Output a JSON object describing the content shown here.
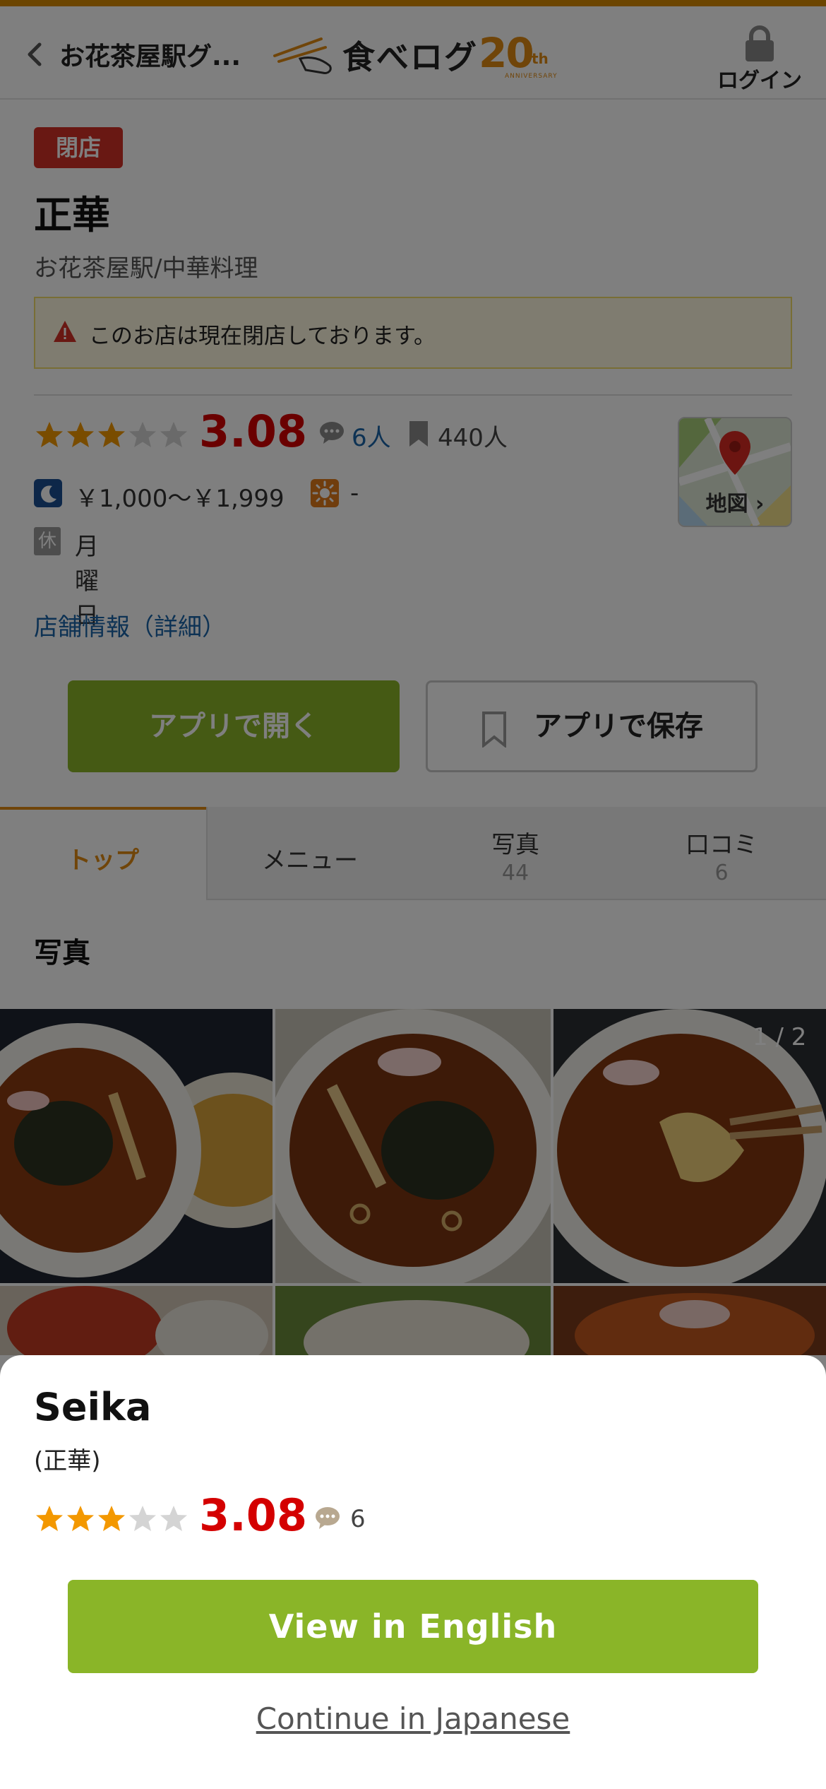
{
  "header": {
    "back_title": "お花茶屋駅グ...",
    "logo_text": "食べログ",
    "logo_anniversary_number": "20",
    "logo_anniversary_suffix": "th",
    "logo_anniversary_word": "ANNIVERSARY",
    "login_label": "ログイン"
  },
  "shop": {
    "closed_badge": "閉店",
    "name": "正華",
    "area_genre": "お花茶屋駅/中華料理",
    "notice": "このお店は現在閉店しております。",
    "rating": 3.08,
    "rating_text": "3.08",
    "review_count": "6人",
    "save_count": "440人",
    "dinner_budget": "￥1,000～￥1,999",
    "lunch_budget": "-",
    "holiday_icon": "休",
    "holiday": "月曜日",
    "map_label": "地図",
    "detail_link": "店舗情報（詳細）"
  },
  "actions": {
    "open_in_app": "アプリで開く",
    "save_in_app": "アプリで保存"
  },
  "tabs": [
    {
      "label": "トップ",
      "count": ""
    },
    {
      "label": "メニュー",
      "count": ""
    },
    {
      "label": "写真",
      "count": "44"
    },
    {
      "label": "口コミ",
      "count": "6"
    }
  ],
  "photos": {
    "heading": "写真",
    "counter": "1 / 2"
  },
  "sheet": {
    "name": "Seika",
    "subtitle": "(正華)",
    "rating_text": "3.08",
    "review_count": "6",
    "primary_button": "View in English",
    "secondary_link": "Continue in Japanese"
  },
  "colors": {
    "accent_orange": "#e08a12",
    "brand_green": "#8ab528",
    "score_red": "#d40000",
    "link_blue": "#1a64a8",
    "closed_red": "#d33027"
  },
  "icons": [
    "back-chevron-icon",
    "lock-icon",
    "warning-icon",
    "star-icon",
    "comment-icon",
    "bookmark-icon",
    "moon-icon",
    "sun-icon",
    "map-pin-icon"
  ]
}
